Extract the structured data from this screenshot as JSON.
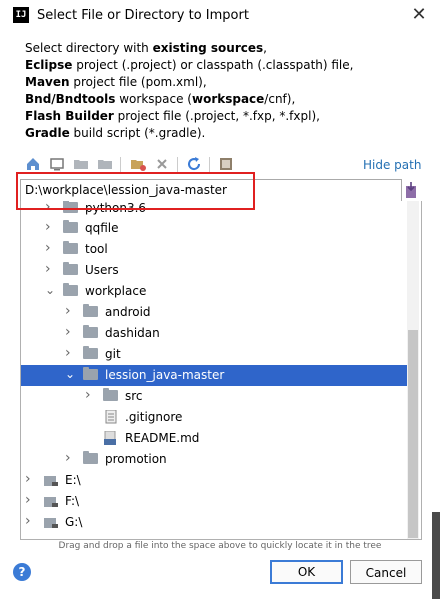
{
  "window": {
    "title": "Select File or Directory to Import",
    "app_icon_text": "IJ"
  },
  "description": {
    "line1_pre": "Select directory with ",
    "line1_bold": "existing sources",
    "line1_post": ",",
    "line2_bold": "Eclipse",
    "line2_post": " project (.project) or classpath (.classpath) file,",
    "line3_bold": "Maven",
    "line3_post": " project file (pom.xml),",
    "line4_bold": "Bnd/Bndtools",
    "line4_mid": " workspace (",
    "line4_bold2": "workspace",
    "line4_post": "/cnf),",
    "line5_bold": "Flash Builder",
    "line5_post": " project file (.project, *.fxp, *.fxpl),",
    "line6_bold": "Gradle",
    "line6_post": " build script (*.gradle)."
  },
  "toolbar": {
    "hide_path_label": "Hide path"
  },
  "path_field": {
    "value": "D:\\workplace\\lession_java-master"
  },
  "tree": {
    "rows": [
      {
        "label": "python3.6",
        "expanded": false,
        "type": "folder"
      },
      {
        "label": "qqfile",
        "expanded": false,
        "type": "folder"
      },
      {
        "label": "tool",
        "expanded": false,
        "type": "folder"
      },
      {
        "label": "Users",
        "expanded": false,
        "type": "folder"
      },
      {
        "label": "workplace",
        "expanded": true,
        "type": "folder"
      },
      {
        "label": "android",
        "expanded": false,
        "type": "folder"
      },
      {
        "label": "dashidan",
        "expanded": false,
        "type": "folder"
      },
      {
        "label": "git",
        "expanded": false,
        "type": "folder"
      },
      {
        "label": "lession_java-master",
        "expanded": true,
        "type": "folder",
        "selected": true
      },
      {
        "label": "src",
        "expanded": false,
        "type": "folder"
      },
      {
        "label": ".gitignore",
        "type": "file"
      },
      {
        "label": "README.md",
        "type": "file"
      },
      {
        "label": "promotion",
        "expanded": false,
        "type": "folder"
      },
      {
        "label": "E:\\",
        "expanded": false,
        "type": "drive"
      },
      {
        "label": "F:\\",
        "expanded": false,
        "type": "drive"
      },
      {
        "label": "G:\\",
        "expanded": false,
        "type": "drive"
      }
    ]
  },
  "hint": "Drag and drop a file into the space above to quickly locate it in the tree",
  "buttons": {
    "ok": "OK",
    "cancel": "Cancel",
    "help": "?"
  },
  "colors": {
    "selection": "#2f65ca",
    "link": "#2470b3",
    "highlight_box": "#e02020"
  }
}
